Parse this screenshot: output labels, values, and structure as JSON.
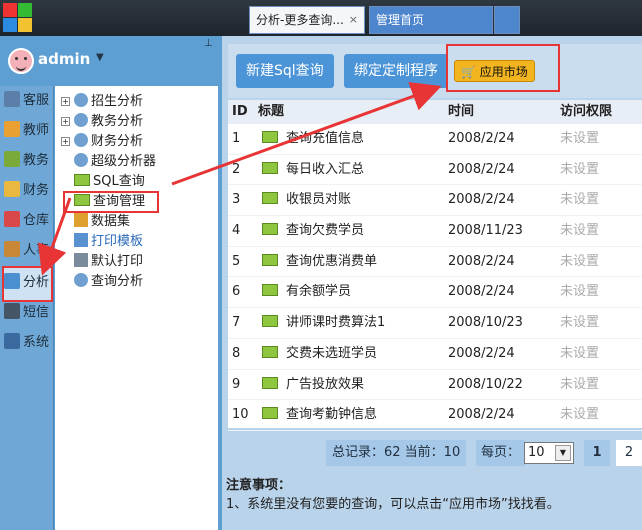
{
  "tabs": [
    {
      "label": "分析-更多查询...",
      "close": "×"
    },
    {
      "label": "管理首页"
    }
  ],
  "user": {
    "name": "admin",
    "dropdown": "▼",
    "pin": "⊥"
  },
  "left_nav": [
    "客服",
    "教师",
    "教务",
    "财务",
    "仓库",
    "人事",
    "分析",
    "短信",
    "系统"
  ],
  "tree": [
    {
      "label": "招生分析",
      "expand": "+"
    },
    {
      "label": "教务分析",
      "expand": "+"
    },
    {
      "label": "财务分析",
      "expand": "+"
    },
    {
      "label": "超级分析器"
    },
    {
      "label": "SQL查询"
    },
    {
      "label": "查询管理"
    },
    {
      "label": "数据集"
    },
    {
      "label": "打印模板"
    },
    {
      "label": "默认打印"
    },
    {
      "label": "查询分析"
    }
  ],
  "toolbar": {
    "new_sql": "新建Sql查询",
    "bind_program": "绑定定制程序",
    "app_market": "应用市场"
  },
  "table": {
    "headers": [
      "ID",
      "标题",
      "时间",
      "访问权限"
    ],
    "rows": [
      {
        "id": "1",
        "title": "查询充值信息",
        "time": "2008/2/24",
        "perm": "未设置"
      },
      {
        "id": "2",
        "title": "每日收入汇总",
        "time": "2008/2/24",
        "perm": "未设置"
      },
      {
        "id": "3",
        "title": "收银员对账",
        "time": "2008/2/24",
        "perm": "未设置"
      },
      {
        "id": "4",
        "title": "查询欠费学员",
        "time": "2008/11/23",
        "perm": "未设置"
      },
      {
        "id": "5",
        "title": "查询优惠消费单",
        "time": "2008/2/24",
        "perm": "未设置"
      },
      {
        "id": "6",
        "title": "有余额学员",
        "time": "2008/2/24",
        "perm": "未设置"
      },
      {
        "id": "7",
        "title": "讲师课时费算法1",
        "time": "2008/10/23",
        "perm": "未设置"
      },
      {
        "id": "8",
        "title": "交费未选班学员",
        "time": "2008/2/24",
        "perm": "未设置"
      },
      {
        "id": "9",
        "title": "广告投放效果",
        "time": "2008/10/22",
        "perm": "未设置"
      },
      {
        "id": "10",
        "title": "查询考勤钟信息",
        "time": "2008/2/24",
        "perm": "未设置"
      }
    ]
  },
  "pager": {
    "summary": "总记录：62 当前：10",
    "per_page_label": "每页：",
    "per_page_value": "10",
    "pages": [
      "1",
      "2"
    ]
  },
  "notes": {
    "title": "注意事项：",
    "line1": "1、系统里没有您要的查询，可以点击“应用市场”找找看。"
  }
}
